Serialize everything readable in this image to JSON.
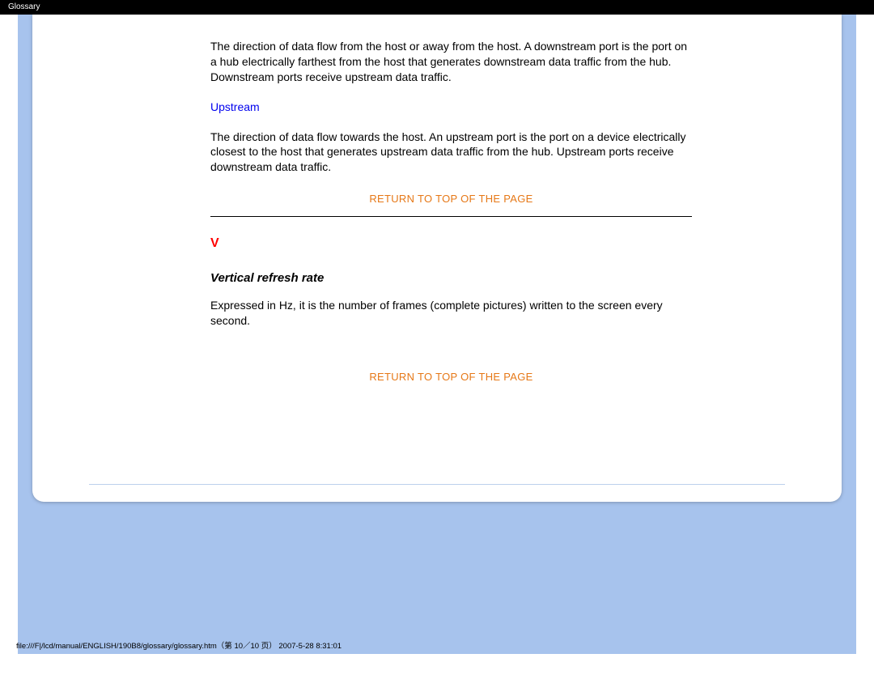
{
  "header": {
    "title": "Glossary"
  },
  "content": {
    "downstream_para": "The direction of data flow from the host or away from the host. A downstream port is the port on a hub electrically farthest from the host that generates downstream data traffic from the hub. Downstream ports receive upstream data traffic.",
    "upstream_term": "Upstream",
    "upstream_para": "The direction of data flow towards the host. An upstream port is the port on a device electrically closest to the host that generates upstream data traffic from the hub. Upstream ports receive downstream data traffic.",
    "return_label": "RETURN TO TOP OF THE PAGE",
    "section_letter": "V",
    "vrr_title": "Vertical refresh rate",
    "vrr_para": "Expressed in Hz, it is the number of frames (complete pictures) written to the screen every second."
  },
  "footer": {
    "path": "file:///F|/lcd/manual/ENGLISH/190B8/glossary/glossary.htm（第 10／10 页）",
    "meta": "2007-5-28 8:31:01"
  }
}
